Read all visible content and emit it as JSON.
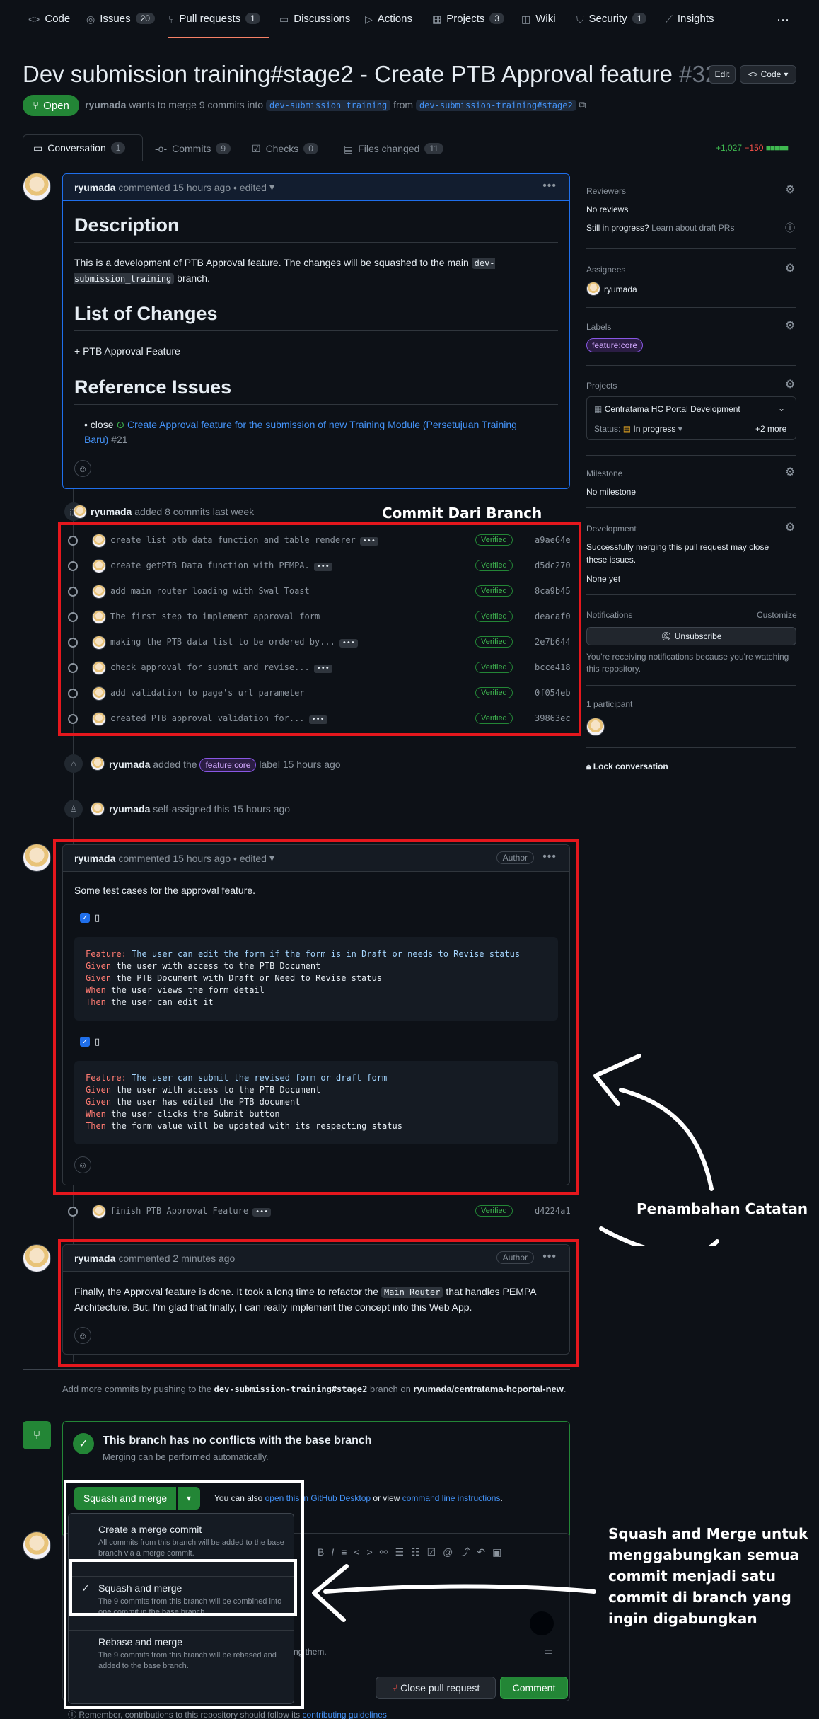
{
  "nav": {
    "items": [
      {
        "icon": "code-icon",
        "label": "Code",
        "count": ""
      },
      {
        "icon": "issue-icon",
        "label": "Issues",
        "count": "20"
      },
      {
        "icon": "pull-request-icon",
        "label": "Pull requests",
        "count": "1"
      },
      {
        "icon": "discussion-icon",
        "label": "Discussions",
        "count": ""
      },
      {
        "icon": "play-icon",
        "label": "Actions",
        "count": ""
      },
      {
        "icon": "table-icon",
        "label": "Projects",
        "count": "3"
      },
      {
        "icon": "book-icon",
        "label": "Wiki",
        "count": ""
      },
      {
        "icon": "shield-icon",
        "label": "Security",
        "count": "1"
      },
      {
        "icon": "graph-icon",
        "label": "Insights",
        "count": ""
      }
    ],
    "more": "⋯"
  },
  "pr": {
    "title": "Dev submission training#stage2 - Create PTB Approval feature",
    "number": "#32",
    "edit_label": "Edit",
    "code_label": "Code",
    "status": "Open",
    "author": "ryumada",
    "meta_text": "wants to merge 9 commits into",
    "base_branch": "dev-submission_training",
    "from_text": "from",
    "head_branch": "dev-submission-training#stage2"
  },
  "tabs": [
    {
      "icon": "comment-icon",
      "label": "Conversation",
      "count": "1"
    },
    {
      "icon": "commit-icon",
      "label": "Commits",
      "count": "9"
    },
    {
      "icon": "checklist-icon",
      "label": "Checks",
      "count": "0"
    },
    {
      "icon": "file-diff-icon",
      "label": "Files changed",
      "count": "11"
    }
  ],
  "diffstat": {
    "added": "+1,027",
    "removed": "−150"
  },
  "first_comment": {
    "author": "ryumada",
    "meta": "commented 15 hours ago • edited",
    "h_description": "Description",
    "p_description_1": "This is a development of PTB Approval feature. The changes will be squashed to the main",
    "p_description_code": "dev-submission_training",
    "p_description_2": "branch.",
    "h_changes": "List of Changes",
    "p_changes": "+ PTB Approval Feature",
    "h_issues": "Reference Issues",
    "issue_prefix": "close",
    "issue_link": "Create Approval feature for the submission of new Training Module (Persetujuan Training Baru)",
    "issue_num": "#21"
  },
  "commits_event": {
    "author": "ryumada",
    "text": "added 8 commits last week"
  },
  "commits": [
    {
      "msg": "create list ptb data function and table renderer",
      "more": true,
      "sha": "a9ae64e"
    },
    {
      "msg": "create getPTB Data function with PEMPA.",
      "more": true,
      "sha": "d5dc270"
    },
    {
      "msg": "add main router loading with Swal Toast",
      "more": false,
      "sha": "8ca9b45"
    },
    {
      "msg": "The first step to implement approval form",
      "more": false,
      "sha": "deacaf0"
    },
    {
      "msg": "making the PTB data list to be ordered by...",
      "more": true,
      "sha": "2e7b644"
    },
    {
      "msg": "check approval for submit and revise...",
      "more": true,
      "sha": "bcce418"
    },
    {
      "msg": "add validation to page's url parameter",
      "more": false,
      "sha": "0f054eb"
    },
    {
      "msg": "created PTB approval validation for...",
      "more": true,
      "sha": "39863ec"
    }
  ],
  "verified_label": "Verified",
  "label_event": {
    "author": "ryumada",
    "pre": "added the",
    "label": "feature:core",
    "post": "label 15 hours ago"
  },
  "assign_event": {
    "author": "ryumada",
    "text": "self-assigned this 15 hours ago"
  },
  "second_comment": {
    "author": "ryumada",
    "meta": "commented 15 hours ago • edited",
    "badge": "Author",
    "intro": "Some test cases for the approval feature.",
    "block1": [
      {
        "kw": "Feature:",
        "text": " The user can edit the form if the form is in Draft or needs to Revise status",
        "kwcolor": "f"
      },
      {
        "kw": "Given",
        "text": " the user with access to the PTB Document",
        "kwcolor": "g"
      },
      {
        "kw": "Given",
        "text": " the PTB Document with Draft or Need to Revise status",
        "kwcolor": "g"
      },
      {
        "kw": "When",
        "text": " the user views the form detail",
        "kwcolor": "g"
      },
      {
        "kw": "Then",
        "text": " the user can edit it",
        "kwcolor": "g"
      }
    ],
    "block2": [
      {
        "kw": "Feature:",
        "text": " The user can submit the revised form or draft form",
        "kwcolor": "f"
      },
      {
        "kw": "Given",
        "text": " the user with access to the PTB Document",
        "kwcolor": "g"
      },
      {
        "kw": "Given",
        "text": " the user has edited the PTB document",
        "kwcolor": "g"
      },
      {
        "kw": "When",
        "text": " the user clicks the Submit button",
        "kwcolor": "g"
      },
      {
        "kw": "Then",
        "text": " the form value will be updated with its respecting status",
        "kwcolor": "g"
      }
    ]
  },
  "last_commit": {
    "msg": "finish PTB Approval Feature",
    "sha": "d4224a1"
  },
  "third_comment": {
    "author": "ryumada",
    "meta": "commented 2 minutes ago",
    "badge": "Author",
    "p1": "Finally, the Approval feature is done. It took a long time to refactor the",
    "code": "Main Router",
    "p2": "that handles PEMPA Architecture. But, I'm glad that finally, I can really implement the concept into this Web App."
  },
  "push_hint": {
    "pre": "Add more commits by pushing to the",
    "branch": "dev-submission-training#stage2",
    "mid": "branch on",
    "repo": "ryumada/centratama-hcportal-new",
    "end": "."
  },
  "merge_box": {
    "title": "This branch has no conflicts with the base branch",
    "subtitle": "Merging can be performed automatically.",
    "button": "Squash and merge",
    "also_pre": "You can also",
    "also_link1": "open this in GitHub Desktop",
    "also_mid": "or view",
    "also_link2": "command line instructions",
    "also_end": "."
  },
  "merge_menu": [
    {
      "title": "Create a merge commit",
      "desc": "All commits from this branch will be added to the base branch via a merge commit.",
      "selected": false
    },
    {
      "title": "Squash and merge",
      "desc": "The 9 commits from this branch will be combined into one commit in the base branch.",
      "selected": true
    },
    {
      "title": "Rebase and merge",
      "desc": "The 9 commits from this branch will be rebased and added to the base branch.",
      "selected": false
    }
  ],
  "composer": {
    "hint": "ting them.",
    "close_label": "Close pull request",
    "comment_label": "Comment",
    "footer_pre": "Remember, contributions to this repository should follow its",
    "footer_link": "contributing guidelines"
  },
  "sidebar": {
    "reviewers_h": "Reviewers",
    "reviewers_v": "No reviews",
    "progress_pre": "Still in progress?",
    "progress_link": "Learn about draft PRs",
    "assignees_h": "Assignees",
    "assignee": "ryumada",
    "labels_h": "Labels",
    "label": "feature:core",
    "projects_h": "Projects",
    "project": "Centratama HC Portal Development",
    "status_pre": "Status:",
    "status": "In progress",
    "more": "+2 more",
    "milestone_h": "Milestone",
    "milestone_v": "No milestone",
    "dev_h": "Development",
    "dev_t": "Successfully merging this pull request may close these issues.",
    "dev_v": "None yet",
    "notif_h": "Notifications",
    "customize": "Customize",
    "unsubscribe": "Unsubscribe",
    "notif_t": "You're receiving notifications because you're watching this repository.",
    "participants": "1 participant",
    "lock": "Lock conversation"
  },
  "annotations": {
    "commit_branch": "Commit Dari Branch",
    "notes": "Penambahan Catatan",
    "squash": "Squash and Merge untuk menggabungkan semua commit menjadi satu commit di branch yang ingin digabungkan"
  },
  "colors": {
    "annotation_red": "#e5171d",
    "accent": "#4493f8",
    "merge_green": "#238636"
  }
}
